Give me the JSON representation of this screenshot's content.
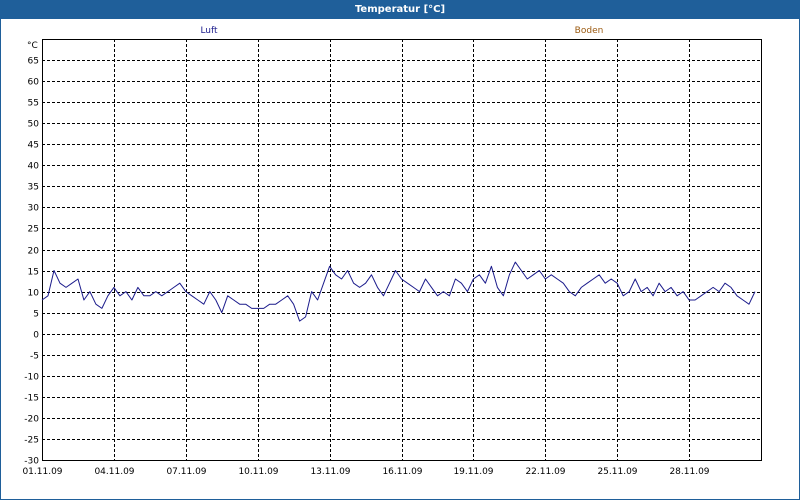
{
  "window": {
    "title": "Temperatur [°C]"
  },
  "chart_data": {
    "type": "line",
    "ylabel": "°C",
    "yunit": "°C",
    "ylim": [
      -30,
      70
    ],
    "yticks": [
      65,
      60,
      55,
      50,
      45,
      40,
      35,
      30,
      25,
      20,
      15,
      10,
      5,
      0,
      -5,
      -10,
      -15,
      -20,
      -25,
      -30
    ],
    "xlim": [
      "2009-11-01",
      "2009-12-01"
    ],
    "xticks": [
      "01.11.09",
      "04.11.09",
      "07.11.09",
      "10.11.09",
      "13.11.09",
      "16.11.09",
      "19.11.09",
      "22.11.09",
      "25.11.09",
      "28.11.09"
    ],
    "grid": true,
    "legend_placement": "top",
    "series": [
      {
        "name": "Luft",
        "color": "#1c1c8c",
        "x": [
          "2009-11-01 00:00",
          "2009-11-01 06:00",
          "2009-11-01 12:00",
          "2009-11-01 18:00",
          "2009-11-02 00:00",
          "2009-11-02 06:00",
          "2009-11-02 12:00",
          "2009-11-02 18:00",
          "2009-11-03 00:00",
          "2009-11-03 06:00",
          "2009-11-03 12:00",
          "2009-11-03 18:00",
          "2009-11-04 00:00",
          "2009-11-04 06:00",
          "2009-11-04 12:00",
          "2009-11-04 18:00",
          "2009-11-05 00:00",
          "2009-11-05 06:00",
          "2009-11-05 12:00",
          "2009-11-05 18:00",
          "2009-11-06 00:00",
          "2009-11-06 06:00",
          "2009-11-06 12:00",
          "2009-11-06 18:00",
          "2009-11-07 00:00",
          "2009-11-07 06:00",
          "2009-11-07 12:00",
          "2009-11-07 18:00",
          "2009-11-08 00:00",
          "2009-11-08 06:00",
          "2009-11-08 12:00",
          "2009-11-08 18:00",
          "2009-11-09 00:00",
          "2009-11-09 06:00",
          "2009-11-09 12:00",
          "2009-11-09 18:00",
          "2009-11-10 00:00",
          "2009-11-10 06:00",
          "2009-11-10 12:00",
          "2009-11-10 18:00",
          "2009-11-11 00:00",
          "2009-11-11 06:00",
          "2009-11-11 12:00",
          "2009-11-11 18:00",
          "2009-11-12 00:00",
          "2009-11-12 06:00",
          "2009-11-12 12:00",
          "2009-11-12 18:00",
          "2009-11-13 00:00",
          "2009-11-13 06:00",
          "2009-11-13 12:00",
          "2009-11-13 18:00",
          "2009-11-14 00:00",
          "2009-11-14 06:00",
          "2009-11-14 12:00",
          "2009-11-14 18:00",
          "2009-11-15 00:00",
          "2009-11-15 06:00",
          "2009-11-15 12:00",
          "2009-11-15 18:00",
          "2009-11-16 00:00",
          "2009-11-16 06:00",
          "2009-11-16 12:00",
          "2009-11-16 18:00",
          "2009-11-17 00:00",
          "2009-11-17 06:00",
          "2009-11-17 12:00",
          "2009-11-17 18:00",
          "2009-11-18 00:00",
          "2009-11-18 06:00",
          "2009-11-18 12:00",
          "2009-11-18 18:00",
          "2009-11-19 00:00",
          "2009-11-19 06:00",
          "2009-11-19 12:00",
          "2009-11-19 18:00",
          "2009-11-20 00:00",
          "2009-11-20 06:00",
          "2009-11-20 12:00",
          "2009-11-20 18:00",
          "2009-11-21 00:00",
          "2009-11-21 06:00",
          "2009-11-21 12:00",
          "2009-11-21 18:00",
          "2009-11-22 00:00",
          "2009-11-22 06:00",
          "2009-11-22 12:00",
          "2009-11-22 18:00",
          "2009-11-23 00:00",
          "2009-11-23 06:00",
          "2009-11-23 12:00",
          "2009-11-23 18:00",
          "2009-11-24 00:00",
          "2009-11-24 06:00",
          "2009-11-24 12:00",
          "2009-11-24 18:00",
          "2009-11-25 00:00",
          "2009-11-25 06:00",
          "2009-11-25 12:00",
          "2009-11-25 18:00",
          "2009-11-26 00:00",
          "2009-11-26 06:00",
          "2009-11-26 12:00",
          "2009-11-26 18:00",
          "2009-11-27 00:00",
          "2009-11-27 06:00",
          "2009-11-27 12:00",
          "2009-11-27 18:00",
          "2009-11-28 00:00",
          "2009-11-28 06:00",
          "2009-11-28 12:00",
          "2009-11-28 18:00",
          "2009-11-29 00:00",
          "2009-11-29 06:00",
          "2009-11-29 12:00",
          "2009-11-29 18:00",
          "2009-11-30 00:00",
          "2009-11-30 06:00",
          "2009-11-30 12:00",
          "2009-11-30 18:00"
        ],
        "y": [
          8,
          9,
          15,
          12,
          11,
          12,
          13,
          8,
          10,
          7,
          6,
          9,
          11,
          9,
          10,
          8,
          11,
          9,
          9,
          10,
          9,
          10,
          11,
          12,
          10,
          9,
          8,
          7,
          10,
          8,
          5,
          9,
          8,
          7,
          7,
          6,
          6,
          6,
          7,
          7,
          8,
          9,
          7,
          3,
          4,
          10,
          8,
          12,
          16,
          14,
          13,
          15,
          12,
          11,
          12,
          14,
          11,
          9,
          12,
          15,
          13,
          12,
          11,
          10,
          13,
          11,
          9,
          10,
          9,
          13,
          12,
          10,
          13,
          14,
          12,
          16,
          11,
          9,
          14,
          17,
          15,
          13,
          14,
          15,
          13,
          14,
          13,
          12,
          10,
          9,
          11,
          12,
          13,
          14,
          12,
          13,
          12,
          9,
          10,
          13,
          10,
          11,
          9,
          12,
          10,
          11,
          9,
          10,
          8,
          8,
          9,
          10,
          11,
          10,
          12,
          11,
          9,
          8,
          7,
          10
        ]
      },
      {
        "name": "Boden",
        "color": "#9b5a10",
        "x": [],
        "y": []
      }
    ]
  }
}
